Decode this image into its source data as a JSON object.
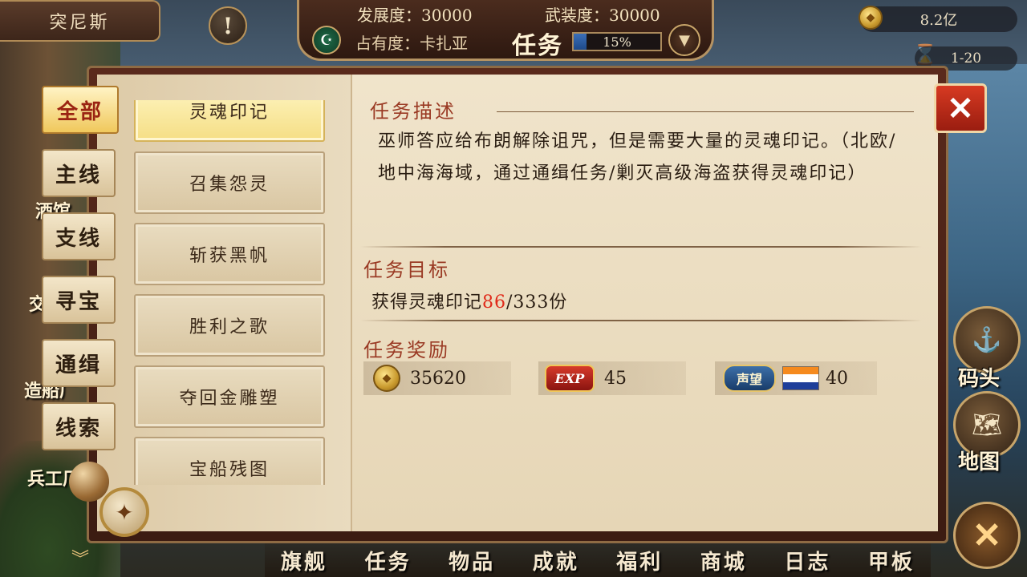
{
  "hud": {
    "city_name": "突尼斯",
    "alert_icon": "exclamation",
    "development_label": "发展度：30000",
    "armament_label": "武装度：30000",
    "occupancy_label": "占有度：卡扎亚",
    "quest_title": "任务",
    "progress_text": "15%",
    "progress_value": 0.15,
    "gold_amount": "8.2亿",
    "level_range": "1-20"
  },
  "tabs": [
    {
      "label": "全部",
      "active": true
    },
    {
      "label": "主线",
      "active": false
    },
    {
      "label": "支线",
      "active": false
    },
    {
      "label": "寻宝",
      "active": false
    },
    {
      "label": "通缉",
      "active": false
    },
    {
      "label": "线索",
      "active": false
    }
  ],
  "quests": [
    {
      "label": "灵魂印记",
      "active": true
    },
    {
      "label": "召集怨灵",
      "active": false
    },
    {
      "label": "斩获黑帆",
      "active": false
    },
    {
      "label": "胜利之歌",
      "active": false
    },
    {
      "label": "夺回金雕塑",
      "active": false
    },
    {
      "label": "宝船残图",
      "active": false
    }
  ],
  "detail": {
    "description_title": "任务描述",
    "description": "巫师答应给布朗解除诅咒，但是需要大量的灵魂印记。（北欧/地中海海域，通过通缉任务/剿灭高级海盗获得灵魂印记）",
    "target_title": "任务目标",
    "target_prefix": "获得灵魂印记",
    "target_current": "86",
    "target_suffix": "/333份",
    "reward_title": "任务奖励",
    "rewards": {
      "gold": "35620",
      "exp_badge": "EXP",
      "exp": "45",
      "fame_badge": "声望",
      "fame": "40"
    },
    "flag_colors": [
      "#f58a1e",
      "#ffffff",
      "#1f3f9a"
    ]
  },
  "side_buttons": {
    "dock_label": "码头",
    "map_label": "地图"
  },
  "left_labels": {
    "tavern": "酒馆",
    "shipyard": "造船厂",
    "arsenal": "兵工厂",
    "trade": "交"
  },
  "bottom_nav": [
    "旗舰",
    "任务",
    "物品",
    "成就",
    "福利",
    "商城",
    "日志",
    "甲板"
  ]
}
